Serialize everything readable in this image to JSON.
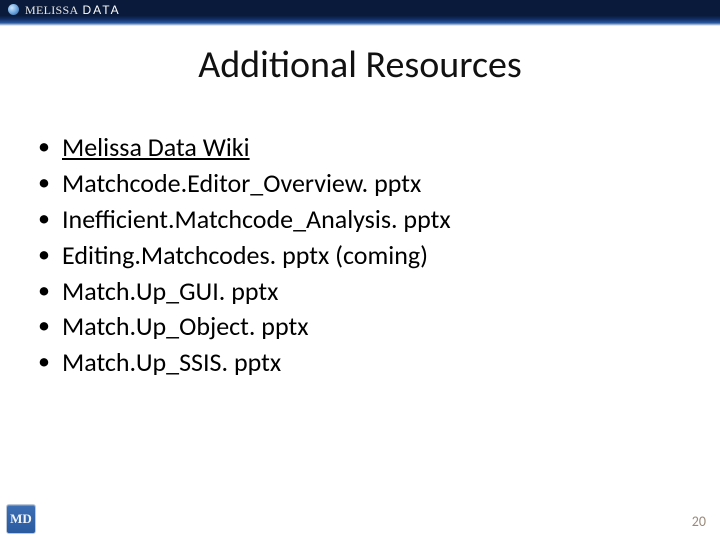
{
  "header": {
    "logo_melissa": "MELISSA",
    "logo_data": "DATA"
  },
  "title": "Additional Resources",
  "bullets": [
    {
      "text": "Melissa Data Wiki",
      "is_link": true
    },
    {
      "text": "Matchcode.Editor_Overview. pptx",
      "is_link": false
    },
    {
      "text": "Inefficient.Matchcode_Analysis. pptx",
      "is_link": false
    },
    {
      "text": "Editing.Matchcodes. pptx (coming)",
      "is_link": false
    },
    {
      "text": "Match.Up_GUI. pptx",
      "is_link": false
    },
    {
      "text": "Match.Up_Object. pptx",
      "is_link": false
    },
    {
      "text": "Match.Up_SSIS. pptx",
      "is_link": false
    }
  ],
  "footer": {
    "icon_text": "MD",
    "page_number": "20"
  }
}
